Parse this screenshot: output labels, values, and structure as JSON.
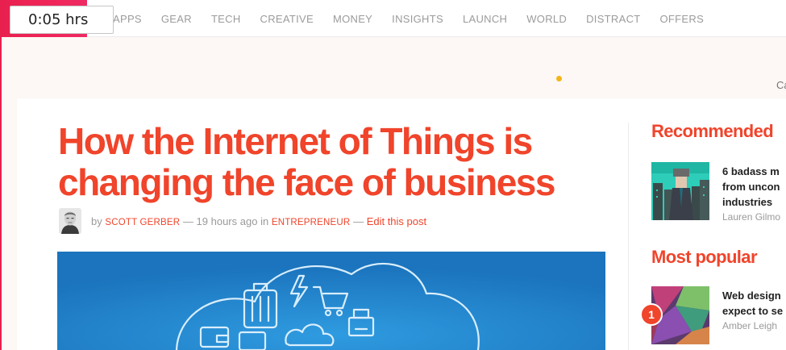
{
  "timer": {
    "label": "0:05 hrs"
  },
  "nav": {
    "items": [
      "APPS",
      "GEAR",
      "TECH",
      "CREATIVE",
      "MONEY",
      "INSIGHTS",
      "LAUNCH",
      "WORLD",
      "DISTRACT",
      "OFFERS"
    ]
  },
  "ad": {
    "partial_text": "Ca"
  },
  "article": {
    "title": "How the Internet of Things is changing the face of business",
    "byline": {
      "by": "by",
      "author": "SCOTT GERBER",
      "sep1": "—",
      "time": "19 hours ago",
      "in": "in",
      "category": "ENTREPRENEUR",
      "sep2": "—",
      "edit": "Edit this post"
    }
  },
  "sidebar": {
    "recommended": {
      "heading": "Recommended",
      "title_lines": [
        "6 badass m",
        "from uncon",
        "industries"
      ],
      "author": "Lauren Gilmo"
    },
    "popular": {
      "heading": "Most popular",
      "rank": "1",
      "title_lines": [
        "Web design",
        "expect to se"
      ],
      "author": "Amber Leigh"
    }
  },
  "colors": {
    "accent": "#f0442b",
    "brand": "#e8204e",
    "hero_blue": "#1f7fc6"
  }
}
